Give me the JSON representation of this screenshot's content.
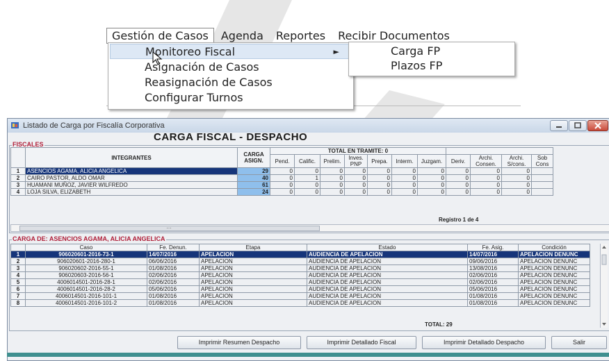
{
  "menu": {
    "items": [
      "Gestión de Casos",
      "Agenda",
      "Reportes",
      "Recibir Documentos"
    ],
    "dropdown": [
      "Monitoreo Fiscal",
      "Asignación de Casos",
      "Reasignación de Casos",
      "Configurar Turnos"
    ],
    "submenu_arrow": "►",
    "submenu": [
      "Carga FP",
      "Plazos FP"
    ]
  },
  "window": {
    "title": "Listado de Carga por Fiscalía Corporativa",
    "heading": "CARGA FISCAL - DESPACHO",
    "fiscales_label": "FISCALES",
    "table1": {
      "headers": {
        "integrantes": "INTEGRANTES",
        "carga": "CARGA ASIGN.",
        "tramite": "TOTAL EN TRAMITE: 0",
        "cols": [
          "Pend.",
          "Calific.",
          "Prelim.",
          "Inves. PNP",
          "Prepa.",
          "Interm.",
          "Juzgam.",
          "Deriv.",
          "Archi. Consen.",
          "Archi. S/cons.",
          "Sob Cons"
        ]
      },
      "rows": [
        {
          "n": "1",
          "name": "ASENCIOS AGAMA, ALICIA ANGELICA",
          "carga": "29",
          "vals": [
            "0",
            "0",
            "0",
            "0",
            "0",
            "0",
            "0",
            "0",
            "0",
            "0",
            ""
          ]
        },
        {
          "n": "2",
          "name": "CAIRO PASTOR, ALDO OMAR",
          "carga": "40",
          "vals": [
            "0",
            "1",
            "0",
            "0",
            "0",
            "0",
            "0",
            "0",
            "0",
            "0",
            ""
          ]
        },
        {
          "n": "3",
          "name": "HUAMANI MUÑOZ, JAVIER WILFREDO",
          "carga": "61",
          "vals": [
            "0",
            "0",
            "0",
            "0",
            "0",
            "0",
            "0",
            "0",
            "0",
            "0",
            ""
          ]
        },
        {
          "n": "4",
          "name": "LOJA SILVA, ELIZABETH",
          "carga": "24",
          "vals": [
            "0",
            "0",
            "0",
            "0",
            "0",
            "0",
            "0",
            "0",
            "0",
            "0",
            ""
          ]
        }
      ],
      "registro": "Registro 1 de 4"
    },
    "hscroll_ellipsis": "…",
    "carga_label": "CARGA DE: ASENCIOS AGAMA, ALICIA ANGELICA",
    "table2": {
      "headers": [
        "Caso",
        "Fe. Denun.",
        "Etapa",
        "Estado",
        "Fe. Asig.",
        "Condición"
      ],
      "rows": [
        {
          "n": "1",
          "caso": "906020601-2016-73-1",
          "fecha": "14/07/2016",
          "etapa": "APELACION",
          "estado": "AUDIENCIA DE APELACION",
          "asig": "14/07/2016",
          "cond": "APELACION DENUNC"
        },
        {
          "n": "2",
          "caso": "906020601-2016-280-1",
          "fecha": "06/06/2016",
          "etapa": "APELACION",
          "estado": "AUDIENCIA DE APELACION",
          "asig": "09/06/2016",
          "cond": "APELACION DENUNC"
        },
        {
          "n": "3",
          "caso": "906020602-2016-55-1",
          "fecha": "01/08/2016",
          "etapa": "APELACION",
          "estado": "AUDIENCIA DE APELACION",
          "asig": "13/08/2016",
          "cond": "APELACION DENUNC"
        },
        {
          "n": "4",
          "caso": "906020603-2016-56-1",
          "fecha": "02/06/2016",
          "etapa": "APELACION",
          "estado": "AUDIENCIA DE APELACION",
          "asig": "02/06/2016",
          "cond": "APELACION DENUNC"
        },
        {
          "n": "5",
          "caso": "4006014501-2016-28-1",
          "fecha": "02/06/2016",
          "etapa": "APELACION",
          "estado": "AUDIENCIA DE APELACION",
          "asig": "02/06/2016",
          "cond": "APELACION DENUNC"
        },
        {
          "n": "6",
          "caso": "4006014501-2016-28-2",
          "fecha": "05/06/2016",
          "etapa": "APELACION",
          "estado": "AUDIENCIA DE APELACION",
          "asig": "05/06/2016",
          "cond": "APELACION DENUNC"
        },
        {
          "n": "7",
          "caso": "4006014501-2016-101-1",
          "fecha": "01/08/2016",
          "etapa": "APELACION",
          "estado": "AUDIENCIA DE APELACION",
          "asig": "01/08/2016",
          "cond": "APELACION DENUNC"
        },
        {
          "n": "8",
          "caso": "4006014501-2016-101-2",
          "fecha": "01/08/2016",
          "etapa": "APELACION",
          "estado": "AUDIENCIA DE APELACION",
          "asig": "01/08/2016",
          "cond": "APELACION DENUNC"
        }
      ],
      "total": "TOTAL: 29"
    },
    "buttons": {
      "resumen": "Imprimir Resumen Despacho",
      "detallado_fiscal": "Imprimir Detallado Fiscal",
      "detallado_despacho": "Imprimir Detallado Despacho",
      "salir": "Salir"
    }
  },
  "colors": {
    "selection": "#16357a",
    "carga_cell": "#8fbfec",
    "section_label": "#b0203a",
    "statusbar": "#3f8f8f"
  }
}
